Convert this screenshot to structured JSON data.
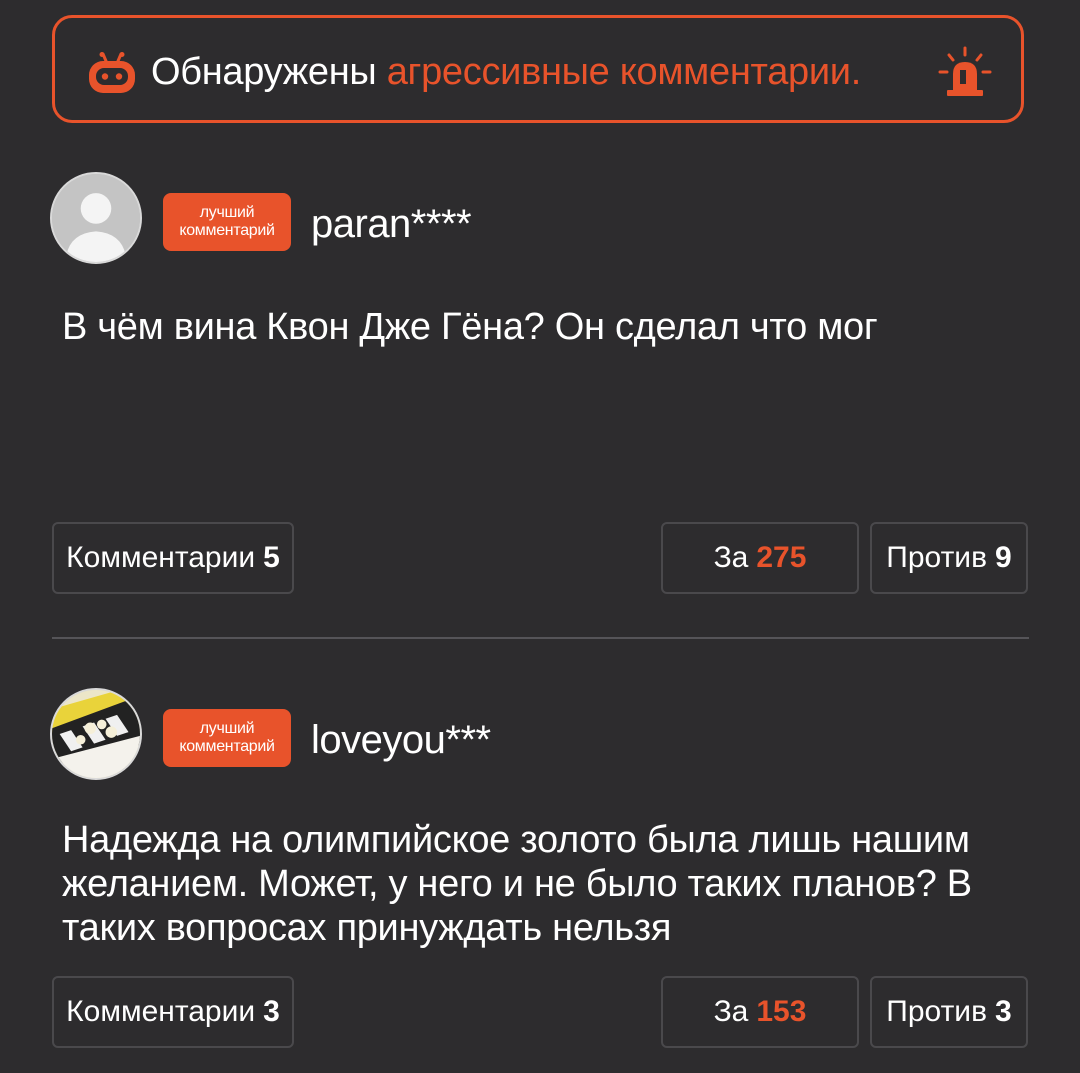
{
  "alert": {
    "text_prefix": "Обнаружены",
    "text_highlight": "агрессивные комментарии.",
    "left_icon": "robot-icon",
    "right_icon": "siren-icon",
    "accent_color": "#e8532b"
  },
  "comments": [
    {
      "badge_line1": "лучший",
      "badge_line2": "комментарий",
      "username": "paran****",
      "text": "В чём вина Квон Дже Гёна? Он сделал что мог",
      "comments_label": "Комментарии",
      "comments_count": "5",
      "for_label": "За",
      "for_count": "275",
      "against_label": "Против",
      "against_count": "9"
    },
    {
      "badge_line1": "лучший",
      "badge_line2": "комментарий",
      "username": "loveyou***",
      "text": "Надежда на олимпийское золото была лишь нашим желанием. Может, у него и не было таких планов? В таких вопросах принуждать нельзя",
      "comments_label": "Комментарии",
      "comments_count": "3",
      "for_label": "За",
      "for_count": "153",
      "against_label": "Против",
      "against_count": "3"
    }
  ]
}
